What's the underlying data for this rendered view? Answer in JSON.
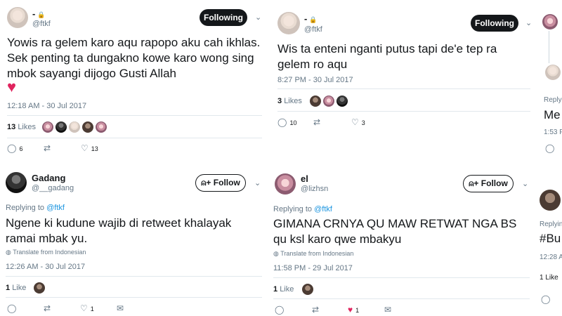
{
  "tweets": [
    {
      "name": "-",
      "handle": "@ftkf",
      "button": "Following",
      "text": "Yowis ra gelem karo aqu rapopo aku cah ikhlas. Sek penting ta dungakno kowe karo wong sing mbok sayangi dijogo Gusti Allah",
      "emoji": "heart",
      "time": "12:18 AM - 30 Jul 2017",
      "likes_count": "13",
      "likes_label": "Likes",
      "actions": {
        "reply": "6",
        "retweet": "",
        "like": "13"
      }
    },
    {
      "name": "-",
      "handle": "@ftkf",
      "button": "Following",
      "text": "Wis ta enteni nganti putus tapi de'e tep ra gelem ro aqu",
      "time": "8:27 PM - 30 Jul 2017",
      "likes_count": "3",
      "likes_label": "Likes",
      "actions": {
        "reply": "10",
        "retweet": "",
        "like": "3"
      }
    },
    {
      "name": "Gadang",
      "handle": "@__gadang",
      "button": "Follow",
      "replying_prefix": "Replying to",
      "replying_to": "@ftkf",
      "text": "Ngene ki kudune wajib di retweet khalayak ramai mbak yu.",
      "translate": "Translate from Indonesian",
      "time": "12:26 AM - 30 Jul 2017",
      "likes_count": "1",
      "likes_label": "Like",
      "actions": {
        "reply": "",
        "retweet": "",
        "like": "1"
      }
    },
    {
      "name": "el",
      "handle": "@lizhsn",
      "button": "Follow",
      "replying_prefix": "Replying to",
      "replying_to": "@ftkf",
      "text": "GIMANA CRNYA QU MAW RETWAT NGA BS qu ksl karo qwe mbakyu",
      "translate": "Translate from Indonesian",
      "time": "11:58 PM - 29 Jul 2017",
      "likes_count": "1",
      "likes_label": "Like",
      "actions": {
        "reply": "",
        "retweet": "",
        "like": "1"
      }
    }
  ],
  "partial_column": {
    "top_text": "Me",
    "top_small_1": "Reply",
    "top_time": "1:53 P",
    "bottom_small": "Replyin",
    "bottom_text": "#Bu",
    "bottom_time": "12:28 A",
    "bottom_likes": "1 Like"
  },
  "icons": {
    "reply": "reply-icon",
    "retweet": "retweet-icon",
    "like": "heart-icon",
    "dm": "envelope-icon",
    "lock": "lock-icon",
    "chevron": "chevron-down-icon",
    "follow": "add-user-icon",
    "globe": "globe-icon"
  },
  "colors": {
    "following_bg": "#14171a",
    "link": "#1b95e0",
    "liked": "#e0245e",
    "muted": "#657786",
    "border": "#e1e8ed"
  }
}
